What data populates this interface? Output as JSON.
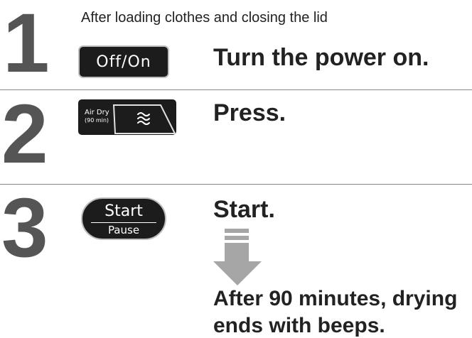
{
  "steps": [
    {
      "number": "1",
      "pre_text": "After loading clothes and closing the lid",
      "button_label": "Off/On",
      "instruction": "Turn the power on."
    },
    {
      "number": "2",
      "button_line1": "Air Dry",
      "button_line2": "(90 min)",
      "button_icon": "airflow-waves-icon",
      "instruction": "Press."
    },
    {
      "number": "3",
      "button_top": "Start",
      "button_bottom": "Pause",
      "instruction": "Start.",
      "result_line1": "After 90 minutes, drying",
      "result_line2": "ends with beeps."
    }
  ],
  "colors": {
    "step_number": "#555555",
    "button_fill": "#1c1c1c",
    "button_border": "#bdbdbd",
    "divider": "#888888",
    "arrow": "#a6a6a6"
  }
}
